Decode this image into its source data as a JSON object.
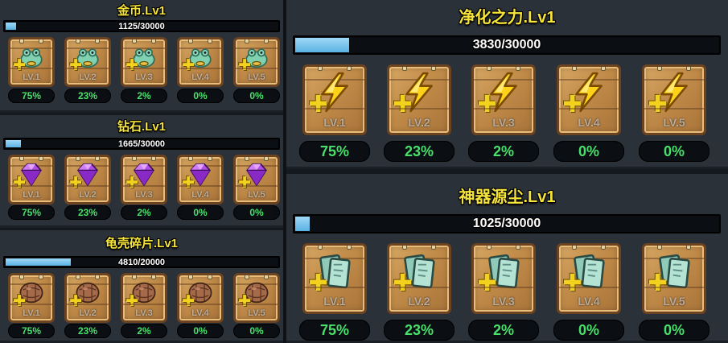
{
  "panels": {
    "gold": {
      "title": "金币.Lv1",
      "progress_text": "1125/30000",
      "progress": 0.0375,
      "item_icon": "jade-toad-icon",
      "slots": [
        {
          "level": "LV.1",
          "pct": "75%"
        },
        {
          "level": "LV.2",
          "pct": "23%"
        },
        {
          "level": "LV.3",
          "pct": "2%"
        },
        {
          "level": "LV.4",
          "pct": "0%"
        },
        {
          "level": "LV.5",
          "pct": "0%"
        }
      ]
    },
    "diamond": {
      "title": "钻石.Lv1",
      "progress_text": "1665/30000",
      "progress": 0.0555,
      "item_icon": "purple-gem-icon",
      "slots": [
        {
          "level": "LV.1",
          "pct": "75%"
        },
        {
          "level": "LV.2",
          "pct": "23%"
        },
        {
          "level": "LV.3",
          "pct": "2%"
        },
        {
          "level": "LV.4",
          "pct": "0%"
        },
        {
          "level": "LV.5",
          "pct": "0%"
        }
      ]
    },
    "shell": {
      "title": "龟壳碎片.Lv1",
      "progress_text": "4810/20000",
      "progress": 0.2405,
      "item_icon": "turtle-shell-icon",
      "slots": [
        {
          "level": "LV.1",
          "pct": "75%"
        },
        {
          "level": "LV.2",
          "pct": "23%"
        },
        {
          "level": "LV.3",
          "pct": "2%"
        },
        {
          "level": "LV.4",
          "pct": "0%"
        },
        {
          "level": "LV.5",
          "pct": "0%"
        }
      ]
    },
    "purify": {
      "title": "净化之力.Lv1",
      "progress_text": "3830/30000",
      "progress": 0.1277,
      "item_icon": "lightning-bolt-icon",
      "slots": [
        {
          "level": "LV.1",
          "pct": "75%"
        },
        {
          "level": "LV.2",
          "pct": "23%"
        },
        {
          "level": "LV.3",
          "pct": "2%"
        },
        {
          "level": "LV.4",
          "pct": "0%"
        },
        {
          "level": "LV.5",
          "pct": "0%"
        }
      ]
    },
    "artifact": {
      "title": "神器源尘.Lv1",
      "progress_text": "1025/30000",
      "progress": 0.0342,
      "item_icon": "crystal-dust-icon",
      "slots": [
        {
          "level": "LV.1",
          "pct": "75%"
        },
        {
          "level": "LV.2",
          "pct": "23%"
        },
        {
          "level": "LV.3",
          "pct": "2%"
        },
        {
          "level": "LV.4",
          "pct": "0%"
        },
        {
          "level": "LV.5",
          "pct": "0%"
        }
      ]
    }
  },
  "colors": {
    "title": "#f6e43a",
    "progress_fill": "#5ab3e3",
    "percent_text": "#48e06a"
  }
}
